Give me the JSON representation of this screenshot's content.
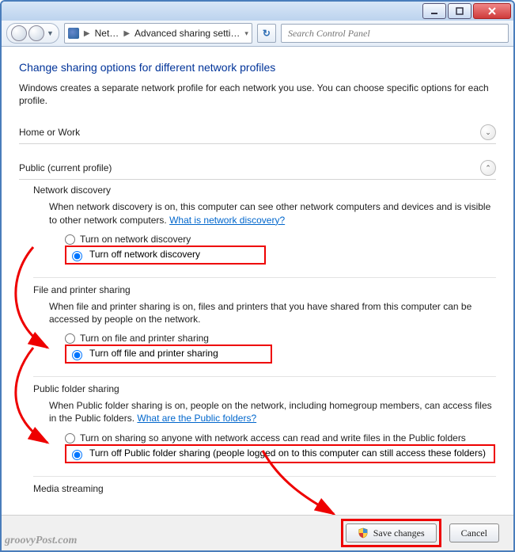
{
  "titlebar": {},
  "nav": {
    "crumb1": "Net…",
    "crumb2": "Advanced sharing setti…",
    "search_placeholder": "Search Control Panel"
  },
  "heading": "Change sharing options for different network profiles",
  "intro": "Windows creates a separate network profile for each network you use. You can choose specific options for each profile.",
  "profiles": {
    "home": {
      "title": "Home or Work"
    },
    "public": {
      "title": "Public (current profile)"
    }
  },
  "groups": {
    "network_discovery": {
      "title": "Network discovery",
      "text_before_link": "When network discovery is on, this computer can see other network computers and devices and is visible to other network computers. ",
      "link": "What is network discovery?",
      "opt_on": "Turn on network discovery",
      "opt_off": "Turn off network discovery"
    },
    "file_printer": {
      "title": "File and printer sharing",
      "text": "When file and printer sharing is on, files and printers that you have shared from this computer can be accessed by people on the network.",
      "opt_on": "Turn on file and printer sharing",
      "opt_off": "Turn off file and printer sharing"
    },
    "public_folder": {
      "title": "Public folder sharing",
      "text_before_link": "When Public folder sharing is on, people on the network, including homegroup members, can access files in the Public folders. ",
      "link": "What are the Public folders?",
      "opt_on": "Turn on sharing so anyone with network access can read and write files in the Public folders",
      "opt_off": "Turn off Public folder sharing (people logged on to this computer can still access these folders)"
    },
    "media": {
      "title": "Media streaming"
    }
  },
  "buttons": {
    "save": "Save changes",
    "cancel": "Cancel"
  },
  "watermark": "groovyPost.com"
}
